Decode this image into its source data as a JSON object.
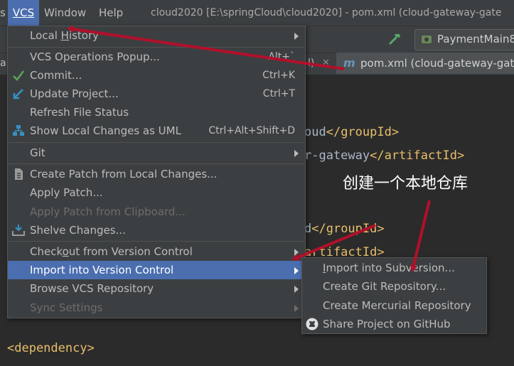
{
  "menubar": {
    "vcs": "VCS",
    "window": "Window",
    "help": "Help",
    "title": "cloud2020 [E:\\springCloud\\cloud2020] - pom.xml (cloud-gateway-gate"
  },
  "toolbar": {
    "run_config": "PaymentMain8"
  },
  "tabs": {
    "partial_left": "ai",
    "partial_mid": "l)",
    "active": "pom.xml (cloud-gateway-gate"
  },
  "editor": {
    "line1_text": "oud",
    "line1_close": "</groupId>",
    "line2_text": "r-gateway",
    "line2_close": "</artifactId>",
    "line3_text": "d",
    "line3_close": "</groupId>",
    "line4_close": "artifactId>",
    "line5": "<dependency>"
  },
  "vcs_menu": {
    "items": [
      {
        "label": "Local History",
        "mnemonic_index": 6
      },
      {
        "label": "VCS Operations Popup...",
        "shortcut": "Alt+`"
      },
      {
        "label": "Commit...",
        "shortcut": "Ctrl+K"
      },
      {
        "label": "Update Project...",
        "shortcut": "Ctrl+T"
      },
      {
        "label": "Refresh File Status"
      },
      {
        "label": "Show Local Changes as UML",
        "shortcut": "Ctrl+Alt+Shift+D"
      },
      {
        "label": "Git"
      },
      {
        "label": "Create Patch from Local Changes..."
      },
      {
        "label": "Apply Patch..."
      },
      {
        "label": "Apply Patch from Clipboard..."
      },
      {
        "label": "Shelve Changes..."
      },
      {
        "label": "Checkout from Version Control"
      },
      {
        "label": "Import into Version Control"
      },
      {
        "label": "Browse VCS Repository"
      },
      {
        "label": "Sync Settings"
      }
    ]
  },
  "import_submenu": {
    "items": [
      {
        "label": "Import into Subversion..."
      },
      {
        "label": "Create Git Repository..."
      },
      {
        "label": "Create Mercurial Repository"
      },
      {
        "label": "Share Project on GitHub"
      }
    ]
  },
  "annotation": "创建一个本地仓库",
  "colors": {
    "selection": "#4b6eaf",
    "arrow": "#b2102a",
    "tag": "#e8bf6a"
  }
}
